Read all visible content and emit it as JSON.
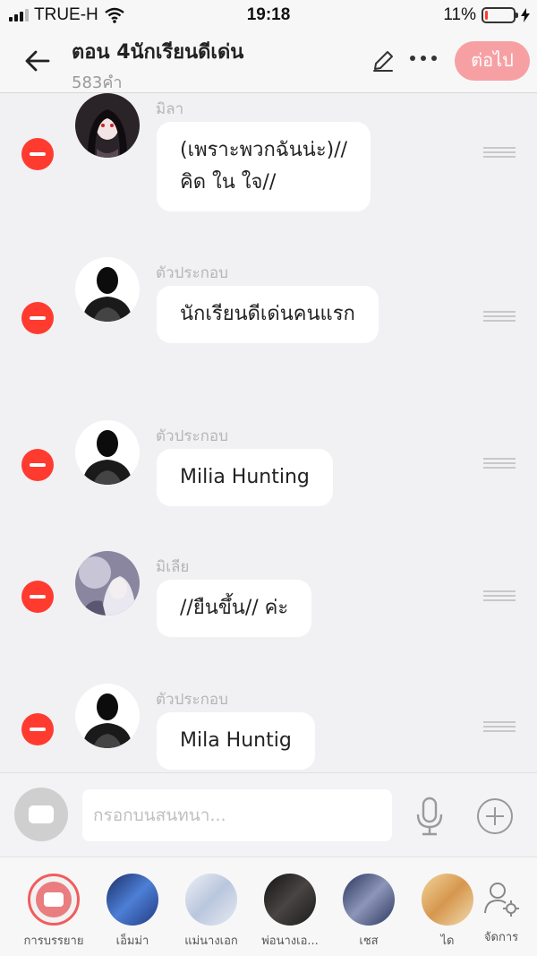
{
  "status": {
    "carrier": "TRUE-H",
    "time": "19:18",
    "battery_percent": "11%",
    "battery_level": 0.11
  },
  "header": {
    "title": "ตอน 4นักเรียนดีเด่น",
    "word_count": "583คำ",
    "next_label": "ต่อไป"
  },
  "messages": [
    {
      "speaker": "มิลา",
      "lines": [
        "(เพราะพวกฉันน่ะ)//",
        "คิด ใน ใจ//"
      ],
      "avatar": "girl-dark-hair-avatar"
    },
    {
      "speaker": "ตัวประกอบ",
      "lines": [
        "นักเรียนดีเด่นคนแรก"
      ],
      "avatar": "silhouette-avatar"
    },
    {
      "speaker": "ตัวประกอบ",
      "lines": [
        "Milia Hunting"
      ],
      "avatar": "silhouette-avatar"
    },
    {
      "speaker": "มิเลีย",
      "lines": [
        "//ยืนขึ้น// ค่ะ"
      ],
      "avatar": "girl-white-hair-avatar"
    },
    {
      "speaker": "ตัวประกอบ",
      "lines": [
        "Mila Huntig"
      ],
      "avatar": "silhouette-avatar"
    }
  ],
  "input": {
    "placeholder": "กรอกบนสนทนา..."
  },
  "characters": [
    {
      "label": "การบรรยาย",
      "selected": true
    },
    {
      "label": "เอ็มม่า",
      "color": "#2b4f9e"
    },
    {
      "label": "แม่นางเอก",
      "color": "#c9d4e6"
    },
    {
      "label": "พ่อนางเอ...",
      "color": "#2a2a2a"
    },
    {
      "label": "เชส",
      "color": "#3a4a7a"
    },
    {
      "label": "ได",
      "color": "#e3b46a"
    }
  ],
  "manage_label": "จัดการ"
}
